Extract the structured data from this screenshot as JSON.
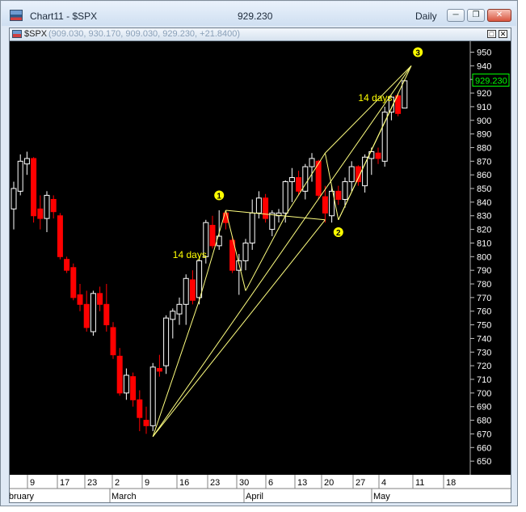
{
  "window": {
    "title": "Chart11 - $SPX",
    "price": "929.230",
    "period": "Daily"
  },
  "chart_header": {
    "symbol": "$SPX",
    "ohlc": "(909.030, 930.170, 909.030, 929.230, +21.8400)"
  },
  "colors": {
    "up": "#ffffff",
    "down": "#ff0000",
    "background": "#000000",
    "trendline": "#ffff80",
    "label": "#ffff00",
    "current_price": "#00ff00"
  },
  "chart_data": {
    "type": "candlestick",
    "current_price": "929.230",
    "ylim": [
      640,
      958
    ],
    "y_ticks": [
      650,
      660,
      670,
      680,
      690,
      700,
      710,
      720,
      730,
      740,
      750,
      760,
      770,
      780,
      790,
      800,
      810,
      820,
      830,
      840,
      850,
      860,
      870,
      880,
      890,
      900,
      910,
      920,
      930,
      940,
      950
    ],
    "x_tick_labels": [
      "9",
      "17",
      "23",
      "2",
      "9",
      "16",
      "23",
      "30",
      "6",
      "13",
      "20",
      "27",
      "4",
      "11",
      "18"
    ],
    "month_labels": [
      "February",
      "March",
      "April",
      "May"
    ],
    "candles": [
      {
        "o": 835,
        "h": 855,
        "l": 820,
        "c": 850
      },
      {
        "o": 848,
        "h": 875,
        "l": 845,
        "c": 870
      },
      {
        "o": 868,
        "h": 877,
        "l": 860,
        "c": 872
      },
      {
        "o": 872,
        "h": 873,
        "l": 825,
        "c": 830
      },
      {
        "o": 835,
        "h": 845,
        "l": 820,
        "c": 828
      },
      {
        "o": 828,
        "h": 848,
        "l": 818,
        "c": 845
      },
      {
        "o": 842,
        "h": 845,
        "l": 828,
        "c": 833
      },
      {
        "o": 830,
        "h": 832,
        "l": 798,
        "c": 800
      },
      {
        "o": 798,
        "h": 800,
        "l": 788,
        "c": 790
      },
      {
        "o": 792,
        "h": 795,
        "l": 768,
        "c": 770
      },
      {
        "o": 772,
        "h": 780,
        "l": 760,
        "c": 765
      },
      {
        "o": 765,
        "h": 775,
        "l": 745,
        "c": 748
      },
      {
        "o": 745,
        "h": 775,
        "l": 742,
        "c": 773
      },
      {
        "o": 773,
        "h": 778,
        "l": 760,
        "c": 765
      },
      {
        "o": 765,
        "h": 780,
        "l": 745,
        "c": 750
      },
      {
        "o": 748,
        "h": 752,
        "l": 725,
        "c": 728
      },
      {
        "o": 727,
        "h": 733,
        "l": 698,
        "c": 700
      },
      {
        "o": 700,
        "h": 718,
        "l": 695,
        "c": 713
      },
      {
        "o": 712,
        "h": 715,
        "l": 690,
        "c": 695
      },
      {
        "o": 695,
        "h": 702,
        "l": 672,
        "c": 682
      },
      {
        "o": 680,
        "h": 690,
        "l": 670,
        "c": 676
      },
      {
        "o": 676,
        "h": 722,
        "l": 672,
        "c": 719
      },
      {
        "o": 718,
        "h": 728,
        "l": 712,
        "c": 716
      },
      {
        "o": 720,
        "h": 757,
        "l": 714,
        "c": 755
      },
      {
        "o": 754,
        "h": 762,
        "l": 740,
        "c": 760
      },
      {
        "o": 758,
        "h": 770,
        "l": 750,
        "c": 765
      },
      {
        "o": 765,
        "h": 787,
        "l": 750,
        "c": 784
      },
      {
        "o": 783,
        "h": 790,
        "l": 765,
        "c": 768
      },
      {
        "o": 770,
        "h": 800,
        "l": 765,
        "c": 797
      },
      {
        "o": 800,
        "h": 827,
        "l": 795,
        "c": 825
      },
      {
        "o": 823,
        "h": 830,
        "l": 806,
        "c": 808
      },
      {
        "o": 808,
        "h": 834,
        "l": 805,
        "c": 815
      },
      {
        "o": 832,
        "h": 834,
        "l": 820,
        "c": 825
      },
      {
        "o": 812,
        "h": 815,
        "l": 788,
        "c": 790
      },
      {
        "o": 790,
        "h": 802,
        "l": 772,
        "c": 797
      },
      {
        "o": 797,
        "h": 813,
        "l": 790,
        "c": 810
      },
      {
        "o": 810,
        "h": 842,
        "l": 805,
        "c": 832
      },
      {
        "o": 832,
        "h": 848,
        "l": 828,
        "c": 843
      },
      {
        "o": 843,
        "h": 846,
        "l": 825,
        "c": 828
      },
      {
        "o": 820,
        "h": 834,
        "l": 815,
        "c": 832
      },
      {
        "o": 830,
        "h": 835,
        "l": 825,
        "c": 832
      },
      {
        "o": 832,
        "h": 856,
        "l": 825,
        "c": 855
      },
      {
        "o": 855,
        "h": 865,
        "l": 840,
        "c": 858
      },
      {
        "o": 858,
        "h": 863,
        "l": 845,
        "c": 848
      },
      {
        "o": 848,
        "h": 868,
        "l": 842,
        "c": 866
      },
      {
        "o": 866,
        "h": 876,
        "l": 855,
        "c": 872
      },
      {
        "o": 870,
        "h": 871,
        "l": 842,
        "c": 845
      },
      {
        "o": 844,
        "h": 852,
        "l": 825,
        "c": 832
      },
      {
        "o": 830,
        "h": 852,
        "l": 825,
        "c": 848
      },
      {
        "o": 848,
        "h": 852,
        "l": 838,
        "c": 842
      },
      {
        "o": 842,
        "h": 858,
        "l": 836,
        "c": 855
      },
      {
        "o": 855,
        "h": 870,
        "l": 848,
        "c": 866
      },
      {
        "o": 866,
        "h": 867,
        "l": 852,
        "c": 855
      },
      {
        "o": 852,
        "h": 875,
        "l": 847,
        "c": 873
      },
      {
        "o": 872,
        "h": 880,
        "l": 860,
        "c": 877
      },
      {
        "o": 876,
        "h": 880,
        "l": 868,
        "c": 872
      },
      {
        "o": 870,
        "h": 910,
        "l": 866,
        "c": 906
      },
      {
        "o": 906,
        "h": 918,
        "l": 900,
        "c": 917
      },
      {
        "o": 918,
        "h": 920,
        "l": 903,
        "c": 905
      },
      {
        "o": 909,
        "h": 930,
        "l": 909,
        "c": 929
      }
    ],
    "trendlines": [
      {
        "from": [
          21,
          668
        ],
        "to": [
          28,
          768
        ]
      },
      {
        "from": [
          28,
          768
        ],
        "to": [
          32,
          834
        ]
      },
      {
        "from": [
          32,
          834
        ],
        "to": [
          35,
          775
        ]
      },
      {
        "from": [
          35,
          775
        ],
        "to": [
          41,
          830
        ]
      },
      {
        "from": [
          32,
          834
        ],
        "to": [
          47,
          827
        ]
      },
      {
        "from": [
          21,
          668
        ],
        "to": [
          47,
          827
        ]
      },
      {
        "from": [
          41,
          830
        ],
        "to": [
          47,
          876
        ]
      },
      {
        "from": [
          47,
          876
        ],
        "to": [
          49,
          827
        ]
      },
      {
        "from": [
          49,
          827
        ],
        "to": [
          58,
          919
        ]
      },
      {
        "from": [
          47,
          876
        ],
        "to": [
          60,
          940
        ]
      },
      {
        "from": [
          49,
          827
        ],
        "to": [
          60,
          940
        ]
      },
      {
        "from": [
          21,
          668
        ],
        "to": [
          60,
          940
        ]
      }
    ],
    "annotations": [
      {
        "text": "14 days",
        "x": 24,
        "y": 799
      },
      {
        "text": "14 days",
        "x": 52,
        "y": 914
      }
    ],
    "wave_labels": [
      {
        "text": "1",
        "x": 31,
        "y": 845
      },
      {
        "text": "2",
        "x": 49,
        "y": 818
      },
      {
        "text": "3",
        "x": 61,
        "y": 950
      }
    ]
  }
}
